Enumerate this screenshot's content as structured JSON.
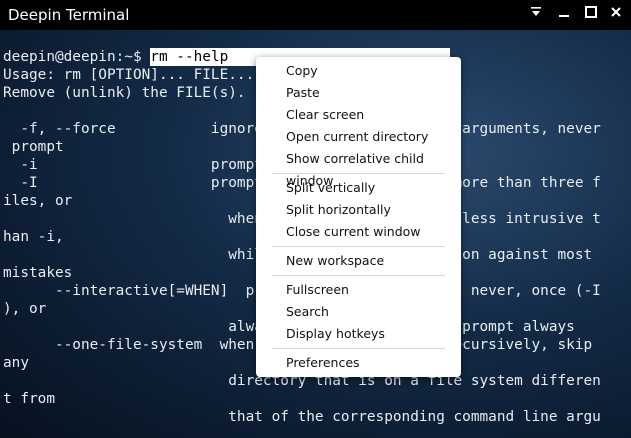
{
  "window": {
    "title": "Deepin Terminal",
    "controls": [
      "menu-icon",
      "minimize-icon",
      "maximize-icon",
      "close-icon"
    ]
  },
  "terminal": {
    "prompt": "deepin@deepin:~$ ",
    "command": "rm --help",
    "lines": [
      "Usage: rm [OPTION]... FILE...",
      "Remove (unlink) the FILE(s).",
      "",
      "  -f, --force           ignore nonexistent files and arguments, never",
      " prompt",
      "  -i                    prompt before every removal",
      "  -I                    prompt once before removing more than three f",
      "iles, or",
      "                          when removing recursively; less intrusive t",
      "han -i,",
      "                          while still giving protection against most",
      "mistakes",
      "      --interactive[=WHEN]  prompt according to WHEN: never, once (-I",
      "), or",
      "                          always (-i); without WHEN, prompt always",
      "      --one-file-system  when removing a hierarchy recursively, skip",
      "any",
      "                          directory that is on a file system differen",
      "t from",
      "                          that of the corresponding command line argu"
    ]
  },
  "context_menu": {
    "groups": [
      [
        "Copy",
        "Paste",
        "Clear screen",
        "Open current directory",
        "Show correlative child window"
      ],
      [
        "Split vertically",
        "Split horizontally",
        "Close current window"
      ],
      [
        "New workspace"
      ],
      [
        "Fullscreen",
        "Search",
        "Display hotkeys"
      ],
      [
        "Preferences"
      ]
    ]
  }
}
